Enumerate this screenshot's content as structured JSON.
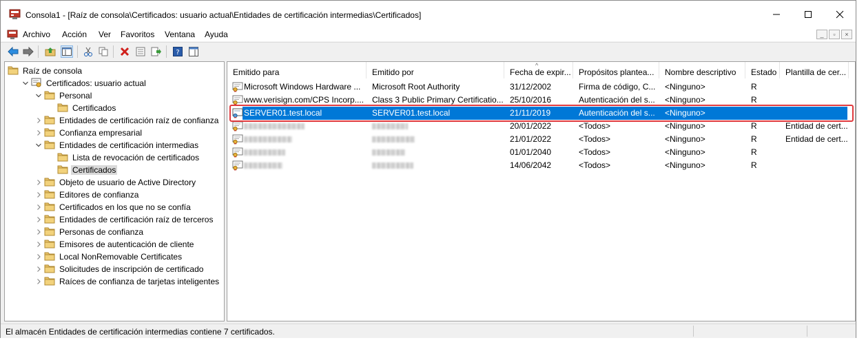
{
  "window": {
    "title": "Consola1 - [Raíz de consola\\Certificados: usuario actual\\Entidades de certificación intermedias\\Certificados]"
  },
  "menu": {
    "items": [
      "Archivo",
      "Acción",
      "Ver",
      "Favoritos",
      "Ventana",
      "Ayuda"
    ]
  },
  "toolbar": {
    "icons": [
      "back-arrow-icon",
      "forward-arrow-icon",
      "up-folder-icon",
      "show-hide-tree-icon",
      "cut-icon",
      "copy-icon",
      "delete-icon",
      "properties-icon",
      "export-icon",
      "help-icon",
      "action-pane-icon"
    ]
  },
  "tree": {
    "nodes": [
      {
        "label": "Raíz de consola"
      },
      {
        "label": "Certificados: usuario actual"
      },
      {
        "label": "Personal"
      },
      {
        "label": "Certificados"
      },
      {
        "label": "Entidades de certificación raíz de confianza"
      },
      {
        "label": "Confianza empresarial"
      },
      {
        "label": "Entidades de certificación intermedias"
      },
      {
        "label": "Lista de revocación de certificados"
      },
      {
        "label": "Certificados"
      },
      {
        "label": "Objeto de usuario de Active Directory"
      },
      {
        "label": "Editores de confianza"
      },
      {
        "label": "Certificados en los que no se confía"
      },
      {
        "label": "Entidades de certificación raíz de terceros"
      },
      {
        "label": "Personas de confianza"
      },
      {
        "label": "Emisores de autenticación de cliente"
      },
      {
        "label": "Local NonRemovable Certificates"
      },
      {
        "label": "Solicitudes de inscripción de certificado"
      },
      {
        "label": "Raíces de confianza de tarjetas inteligentes"
      }
    ]
  },
  "list": {
    "columns": [
      "Emitido para",
      "Emitido por",
      "Fecha de expir...",
      "Propósitos plantea...",
      "Nombre descriptivo",
      "Estado",
      "Plantilla de cer..."
    ],
    "rows": [
      {
        "issued_to": "Microsoft Windows Hardware ...",
        "issued_by": "Microsoft Root Authority",
        "expiry": "31/12/2002",
        "purposes": "Firma de código, C...",
        "friendly": "<Ninguno>",
        "status": "R",
        "template": ""
      },
      {
        "issued_to": "www.verisign.com/CPS Incorp....",
        "issued_by": "Class 3 Public Primary Certificatio...",
        "expiry": "25/10/2016",
        "purposes": "Autenticación del s...",
        "friendly": "<Ninguno>",
        "status": "R",
        "template": ""
      },
      {
        "issued_to": "SERVER01.test.local",
        "issued_by": "SERVER01.test.local",
        "expiry": "21/11/2019",
        "purposes": "Autenticación del s...",
        "friendly": "<Ninguno>",
        "status": "",
        "template": ""
      },
      {
        "issued_to": "",
        "issued_by": "",
        "expiry": "20/01/2022",
        "purposes": "<Todos>",
        "friendly": "<Ninguno>",
        "status": "R",
        "template": "Entidad de cert..."
      },
      {
        "issued_to": "",
        "issued_by": "",
        "expiry": "21/01/2022",
        "purposes": "<Todos>",
        "friendly": "<Ninguno>",
        "status": "R",
        "template": "Entidad de cert..."
      },
      {
        "issued_to": "",
        "issued_by": "",
        "expiry": "01/01/2040",
        "purposes": "<Todos>",
        "friendly": "<Ninguno>",
        "status": "R",
        "template": ""
      },
      {
        "issued_to": "",
        "issued_by": "",
        "expiry": "14/06/2042",
        "purposes": "<Todos>",
        "friendly": "<Ninguno>",
        "status": "R",
        "template": ""
      }
    ]
  },
  "statusbar": {
    "text": "El almacén Entidades de certificación intermedias contiene 7 certificados."
  },
  "colors": {
    "selection": "#0078d7",
    "highlight_box": "#e0393d",
    "folder": "#e8c26a"
  }
}
